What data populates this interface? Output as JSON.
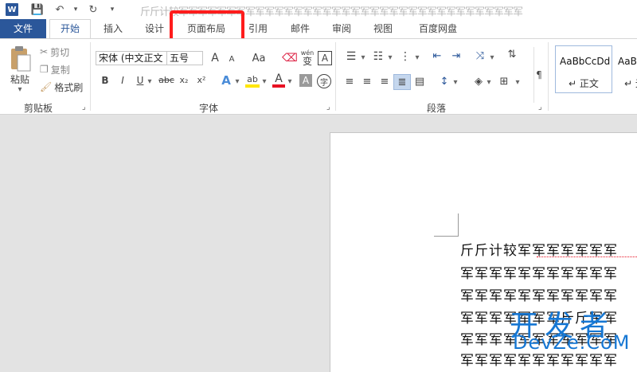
{
  "titlebar": {
    "title": "斤斤计较军军军军军军军军军军军军军军军军军军军军军军军军军军军军军军军军军军军军",
    "word_icon": "W",
    "save_icon": "💾",
    "undo_icon": "↶",
    "redo_icon": "↻"
  },
  "tabs": [
    "文件",
    "开始",
    "插入",
    "设计",
    "页面布局",
    "引用",
    "邮件",
    "审阅",
    "视图",
    "百度网盘"
  ],
  "clipboard": {
    "paste": "粘贴",
    "cut": "剪切",
    "copy": "复制",
    "format_painter": "格式刷",
    "group_label": "剪贴板"
  },
  "font": {
    "name": "宋体 (中文正文",
    "size": "五号",
    "grow": "A",
    "shrink": "A",
    "case": "Aa",
    "phonetic": "wén",
    "phonetic_char": "变",
    "border_char": "A",
    "bold": "B",
    "italic": "I",
    "underline": "U",
    "strike": "abc",
    "subscript": "x₂",
    "superscript": "x²",
    "effects": "A",
    "highlight": "ab",
    "color": "A",
    "shading": "A",
    "enclose": "字",
    "group_label": "字体"
  },
  "paragraph": {
    "group_label": "段落"
  },
  "styles": [
    {
      "sample": "AaBbCcDd",
      "name": "正文"
    },
    {
      "sample": "AaBl",
      "name": "无"
    }
  ],
  "doc": {
    "lines": [
      "斤斤计较军军军军军军军",
      "军军军军军军军军军军军",
      "军军军军军军军军军军军",
      "军军军军军军军斤斤军军",
      "军军军军军军军军军军军",
      "军军军军军军军军军军军"
    ]
  },
  "watermark": {
    "line1": "开发者",
    "line2": "DevZe.CoM"
  },
  "colors": {
    "accent": "#2b579a",
    "highlight_border": "#ff1c1c",
    "watermark": "#1677d3"
  }
}
